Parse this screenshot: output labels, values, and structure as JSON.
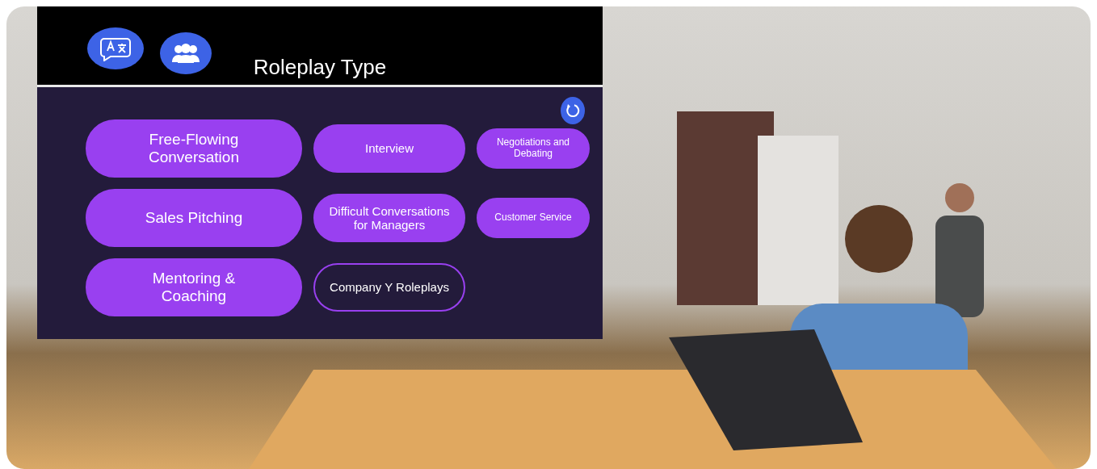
{
  "panel": {
    "title": "Roleplay Type",
    "options": [
      {
        "label": "Free-Flowing Conversation",
        "kind": "filled"
      },
      {
        "label": "Interview",
        "kind": "filled"
      },
      {
        "label": "Negotiations and Debating",
        "kind": "filled"
      },
      {
        "label": "Sales Pitching",
        "kind": "filled"
      },
      {
        "label": "Difficult Conversations for Managers",
        "kind": "filled"
      },
      {
        "label": "Customer Service",
        "kind": "filled"
      },
      {
        "label": "Mentoring & Coaching",
        "kind": "filled"
      },
      {
        "label": "Company Y Roleplays",
        "kind": "outlined"
      }
    ]
  }
}
